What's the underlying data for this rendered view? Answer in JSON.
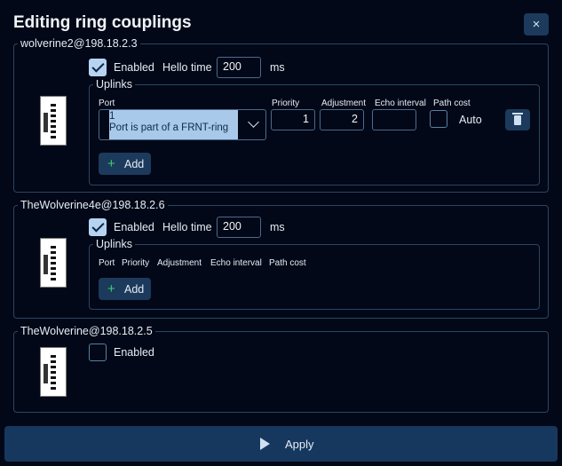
{
  "dialog": {
    "title": "Editing ring couplings",
    "close_icon": "×"
  },
  "devices": [
    {
      "name": "wolverine2@198.18.2.3",
      "enabled_label": "Enabled",
      "enabled": true,
      "hello_time_label": "Hello time",
      "hello_time": "200",
      "hello_unit": "ms",
      "uplinks_label": "Uplinks",
      "columns": {
        "port": "Port",
        "priority": "Priority",
        "adjustment": "Adjustment",
        "echo_interval": "Echo interval",
        "path_cost": "Path cost"
      },
      "uplink": {
        "port_value": "1",
        "port_desc": "Port is part of a FRNT-ring",
        "priority": "1",
        "adjustment": "2",
        "echo_interval": "",
        "path_cost_auto": false,
        "auto_label": "Auto"
      },
      "add_label": "Add"
    },
    {
      "name": "TheWolverine4e@198.18.2.6",
      "enabled_label": "Enabled",
      "enabled": true,
      "hello_time_label": "Hello time",
      "hello_time": "200",
      "hello_unit": "ms",
      "uplinks_label": "Uplinks",
      "columns": {
        "port": "Port",
        "priority": "Priority",
        "adjustment": "Adjustment",
        "echo_interval": "Echo interval",
        "path_cost": "Path cost"
      },
      "add_label": "Add"
    },
    {
      "name": "TheWolverine@198.18.2.5",
      "enabled_label": "Enabled",
      "enabled": false
    }
  ],
  "apply_label": "Apply",
  "colors": {
    "background": "#020817",
    "button": "#1c3a5c",
    "accent": "#a9c9ea",
    "add_icon": "#3ecf6a"
  }
}
